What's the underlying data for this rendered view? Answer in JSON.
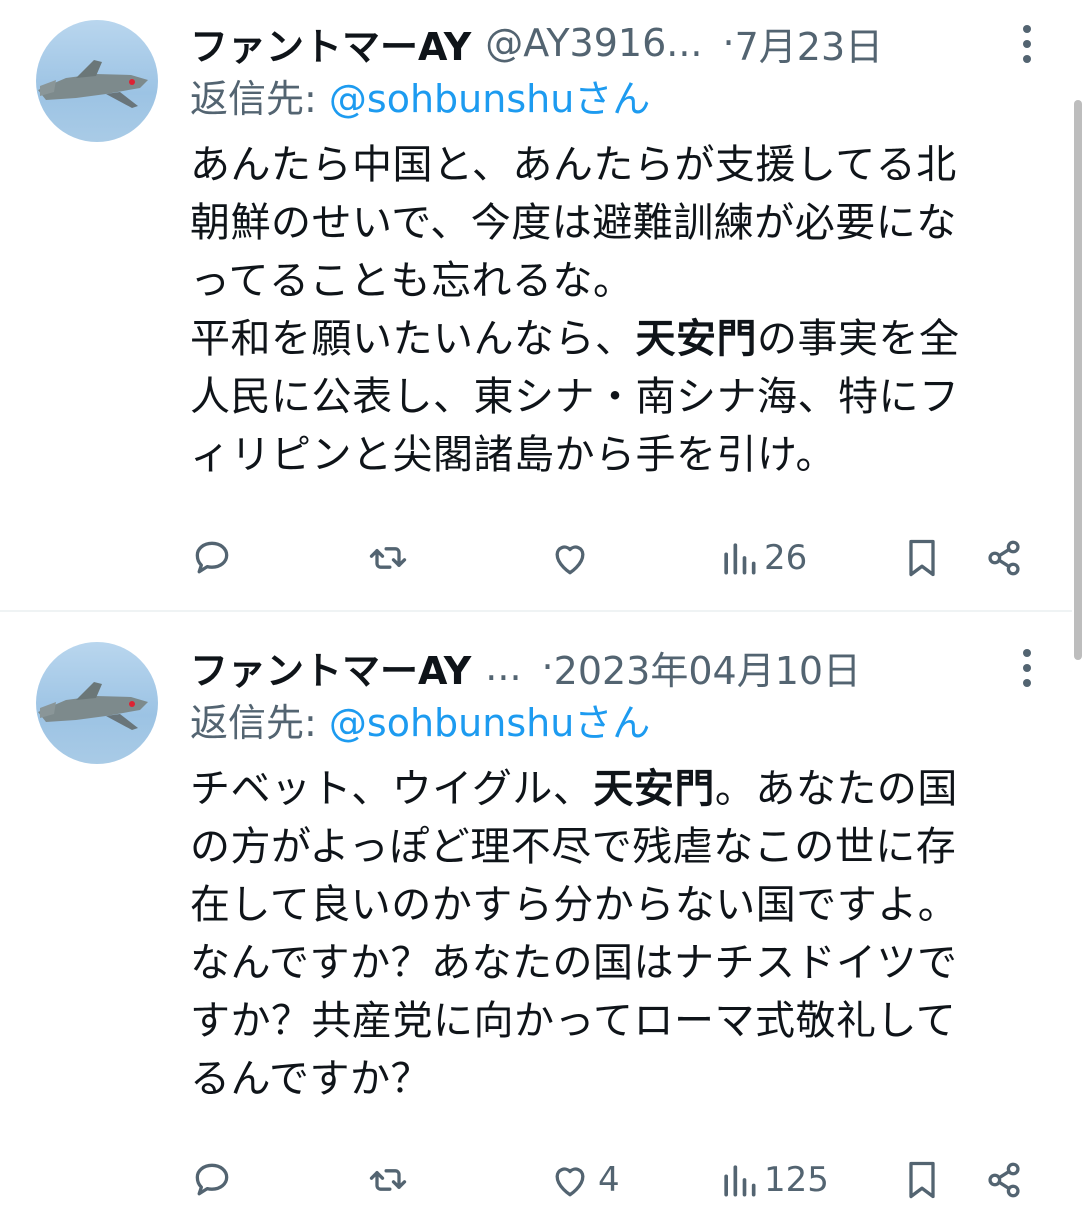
{
  "tweets": [
    {
      "name": "ファントマーAY",
      "handle": "@AY3916...",
      "dot": "·",
      "date": "7月23日",
      "reply_prefix": "返信先:",
      "reply_mention": "@sohbunshu",
      "reply_suffix": "さん",
      "body_lines": [
        [
          "あんたら中国と、あんたらが支援してる北"
        ],
        [
          "朝鮮のせいで、今度は避難訓練が必要にな"
        ],
        [
          "ってることも忘れるな。"
        ],
        [
          "平和を願いたいんなら、",
          "天安門",
          "の事実を全"
        ],
        [
          "人民に公表し、東シナ・南シナ海、特にフ"
        ],
        [
          "ィリピンと尖閣諸島から手を引け。"
        ]
      ],
      "like_count": "",
      "view_count": "26"
    },
    {
      "name": "ファントマーAY",
      "handle": "...",
      "dot": "·",
      "date": "2023年04月10日",
      "reply_prefix": "返信先:",
      "reply_mention": "@sohbunshu",
      "reply_suffix": "さん",
      "body_lines": [
        [
          "チベット、ウイグル、",
          "天安門",
          "。あなたの国"
        ],
        [
          "の方がよっぽど理不尽で残虐なこの世に存"
        ],
        [
          "在して良いのかすら分からない国ですよ。"
        ],
        [
          "なんですか？あなたの国はナチスドイツで"
        ],
        [
          "すか？共産党に向かってローマ式敬礼して"
        ],
        [
          "るんですか？"
        ]
      ],
      "like_count": "4",
      "view_count": "125"
    }
  ],
  "icons": {
    "reply": "speech-bubble-icon",
    "retweet": "retweet-icon",
    "like": "heart-icon",
    "views": "bar-chart-icon",
    "bookmark": "bookmark-icon",
    "share": "share-icon",
    "more": "more-vertical-icon"
  },
  "colors": {
    "text": "#0f1419",
    "secondary": "#536471",
    "link": "#1d9bf0",
    "divider": "#eff3f4"
  }
}
